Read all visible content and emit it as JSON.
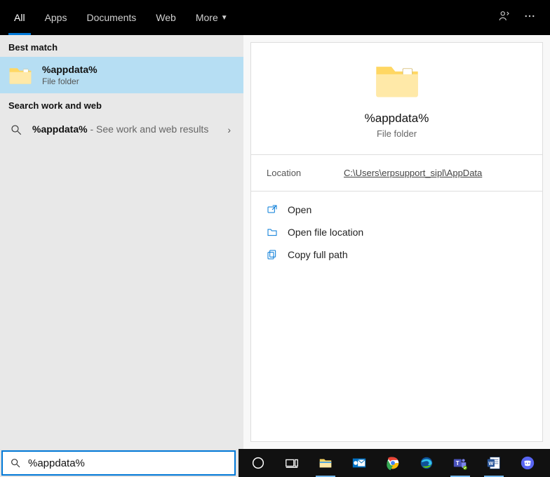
{
  "topbar": {
    "tabs": {
      "all": "All",
      "apps": "Apps",
      "documents": "Documents",
      "web": "Web",
      "more": "More"
    }
  },
  "left": {
    "best_match_label": "Best match",
    "result": {
      "title": "%appdata%",
      "subtitle": "File folder"
    },
    "work_web_label": "Search work and web",
    "web_result": {
      "term": "%appdata%",
      "suffix": " - See work and web results"
    }
  },
  "preview": {
    "title": "%appdata%",
    "type": "File folder",
    "location_label": "Location",
    "location_value": "C:\\Users\\erpsupport_sipl\\AppData",
    "actions": {
      "open": "Open",
      "open_location": "Open file location",
      "copy_path": "Copy full path"
    }
  },
  "search": {
    "value": "%appdata%"
  }
}
